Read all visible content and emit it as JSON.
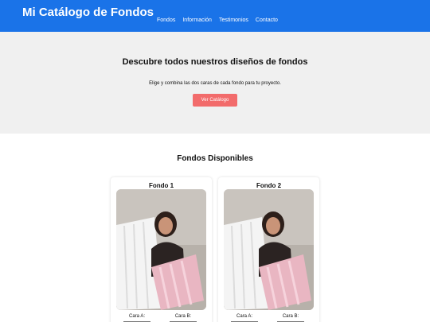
{
  "header": {
    "brand": "Mi Catálogo de Fondos",
    "nav": [
      "Fondos",
      "Información",
      "Testimonios",
      "Contacto"
    ]
  },
  "hero": {
    "title": "Descubre todos nuestros diseños de fondos",
    "subtitle": "Elige y combina las dos caras de cada fondo para tu proyecto.",
    "button": "Ver Catálogo"
  },
  "section": {
    "title": "Fondos Disponibles"
  },
  "cards": [
    {
      "title": "Fondo 1",
      "cara_a": "Cara A:",
      "cara_b": "Cara B:"
    },
    {
      "title": "Fondo 2",
      "cara_a": "Cara A:",
      "cara_b": "Cara B:"
    }
  ],
  "colors": {
    "header": "#1a73e8",
    "button": "#f26b6b",
    "hero_bg": "#f0f0f0"
  }
}
